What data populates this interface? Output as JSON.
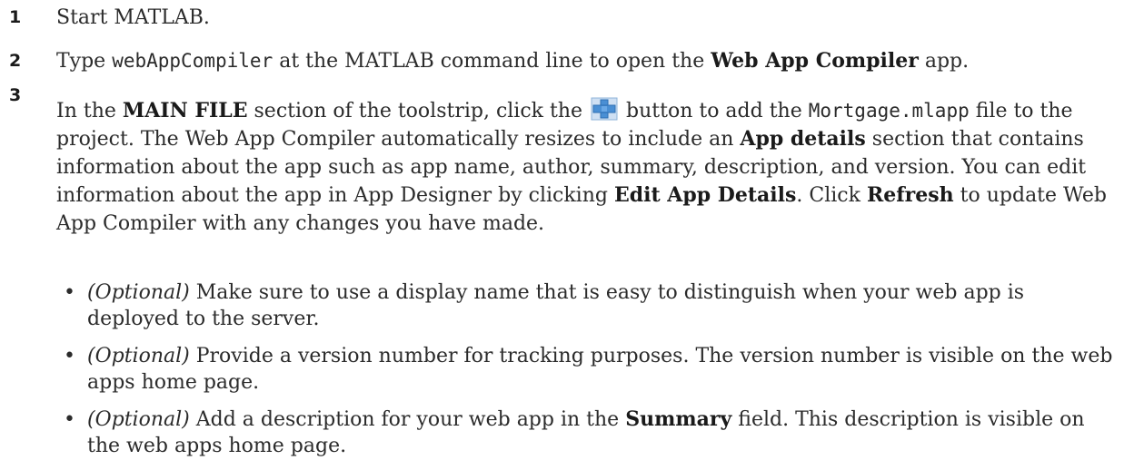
{
  "steps": [
    {
      "number": "1",
      "text": "Start MATLAB."
    },
    {
      "number": "2",
      "part1": "Type ",
      "code": "webAppCompiler",
      "part2": " at the MATLAB command line to open the ",
      "bold1": "Web App Compiler",
      "part3": " app."
    },
    {
      "number": "3",
      "part1": "In the ",
      "bold1": "MAIN FILE",
      "part2": " section of the toolstrip, click the ",
      "icon": "add-file-plus-icon",
      "part3": " button to add the ",
      "code": "Mortgage.mlapp",
      "part4": " file to the project. The Web App Compiler automatically resizes to include an ",
      "bold2": "App details",
      "part5": " section that contains information about the app such as app name, author, summary, description, and version. You can edit information about the app in App Designer by clicking ",
      "bold3": "Edit App Details",
      "part6": ". Click ",
      "bold4": "Refresh",
      "part7": " to update Web App Compiler with any changes you have made."
    }
  ],
  "bullets": [
    {
      "optional": "(Optional)",
      "text": " Make sure to use a display name that is easy to distinguish when your web app is deployed to the server."
    },
    {
      "optional": "(Optional)",
      "text": " Provide a version number for tracking purposes. The version number is visible on the web apps home page."
    },
    {
      "optional": "(Optional)",
      "text_before": " Add a description for your web app in the ",
      "bold": "Summary",
      "text_after": " field. This description is visible on the web apps home page."
    }
  ],
  "bullet_symbol": "•",
  "colors": {
    "text": "#2b2b2b",
    "icon_blue": "#4a8fd4",
    "icon_bg": "#b9d3ee"
  }
}
